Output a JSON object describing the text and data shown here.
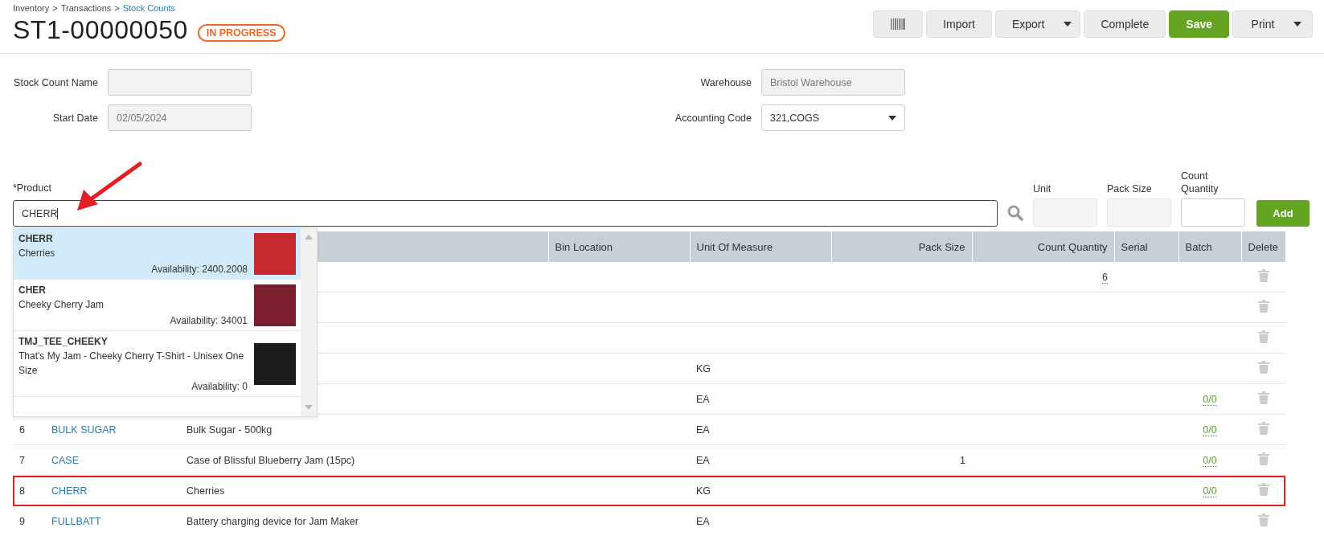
{
  "breadcrumb": [
    {
      "label": "Inventory",
      "link": false
    },
    {
      "label": "Transactions",
      "link": false
    },
    {
      "label": "Stock Counts",
      "link": true
    }
  ],
  "breadcrumb_separator": ">",
  "title": "ST1-00000050",
  "status_badge": "IN PROGRESS",
  "toolbar": [
    {
      "kind": "barcode"
    },
    {
      "kind": "button",
      "label": "Import"
    },
    {
      "kind": "split",
      "label": "Export"
    },
    {
      "kind": "button",
      "label": "Complete"
    },
    {
      "kind": "primary",
      "label": "Save"
    },
    {
      "kind": "split",
      "label": "Print"
    }
  ],
  "form_left": [
    {
      "label": "Stock Count Name",
      "kind": "text",
      "disabled": true
    },
    {
      "label": "Start Date",
      "kind": "text",
      "value": "02/05/2024",
      "disabled": true
    }
  ],
  "form_right": [
    {
      "label": "Warehouse",
      "kind": "text",
      "value": "Bristol Warehouse",
      "disabled": true
    },
    {
      "label": "Accounting Code",
      "kind": "select",
      "value": "321,COGS",
      "disabled": false
    }
  ],
  "product": {
    "label": "*Product",
    "value": "CHERR",
    "unit_label": "Unit",
    "pack_size_label": "Pack Size",
    "count_quantity_label": "Count Quantity",
    "add_label": "Add"
  },
  "suggestions": [
    {
      "code": "CHERR",
      "name": "Cherries",
      "availability": "Availability: 2400.2008",
      "selected": true
    },
    {
      "code": "CHER",
      "name": "Cheeky Cherry Jam",
      "availability": "Availability: 34001",
      "selected": false
    },
    {
      "code": "TMJ_TEE_CHEEKY",
      "name": "That's My Jam - Cheeky Cherry T-Shirt - Unisex One Size",
      "availability": "Availability: 0",
      "selected": false
    }
  ],
  "table": {
    "columns": [
      "Bin Location",
      "Unit Of Measure",
      "Pack Size",
      "Count Quantity",
      "Serial",
      "Batch",
      "Delete"
    ],
    "rows": [
      {
        "count_quantity": "6",
        "highlighted": false
      },
      {
        "highlighted": false
      },
      {
        "highlighted": false
      },
      {
        "uom": "KG",
        "highlighted": false
      },
      {
        "uom": "EA",
        "batch": "0/0",
        "highlighted": false
      },
      {
        "number": "6",
        "code": "BULK SUGAR",
        "description": "Bulk Sugar - 500kg",
        "uom": "EA",
        "batch": "0/0",
        "highlighted": false
      },
      {
        "number": "7",
        "code": "CASE",
        "description": "Case of Blissful Blueberry Jam (15pc)",
        "uom": "EA",
        "pack_size": "1",
        "batch": "0/0",
        "highlighted": false
      },
      {
        "number": "8",
        "code": "CHERR",
        "description": "Cherries",
        "uom": "KG",
        "batch": "0/0",
        "highlighted": true
      },
      {
        "number": "9",
        "code": "FULLBATT",
        "description": "Battery charging device for Jam Maker",
        "uom": "EA",
        "highlighted": false
      }
    ]
  }
}
